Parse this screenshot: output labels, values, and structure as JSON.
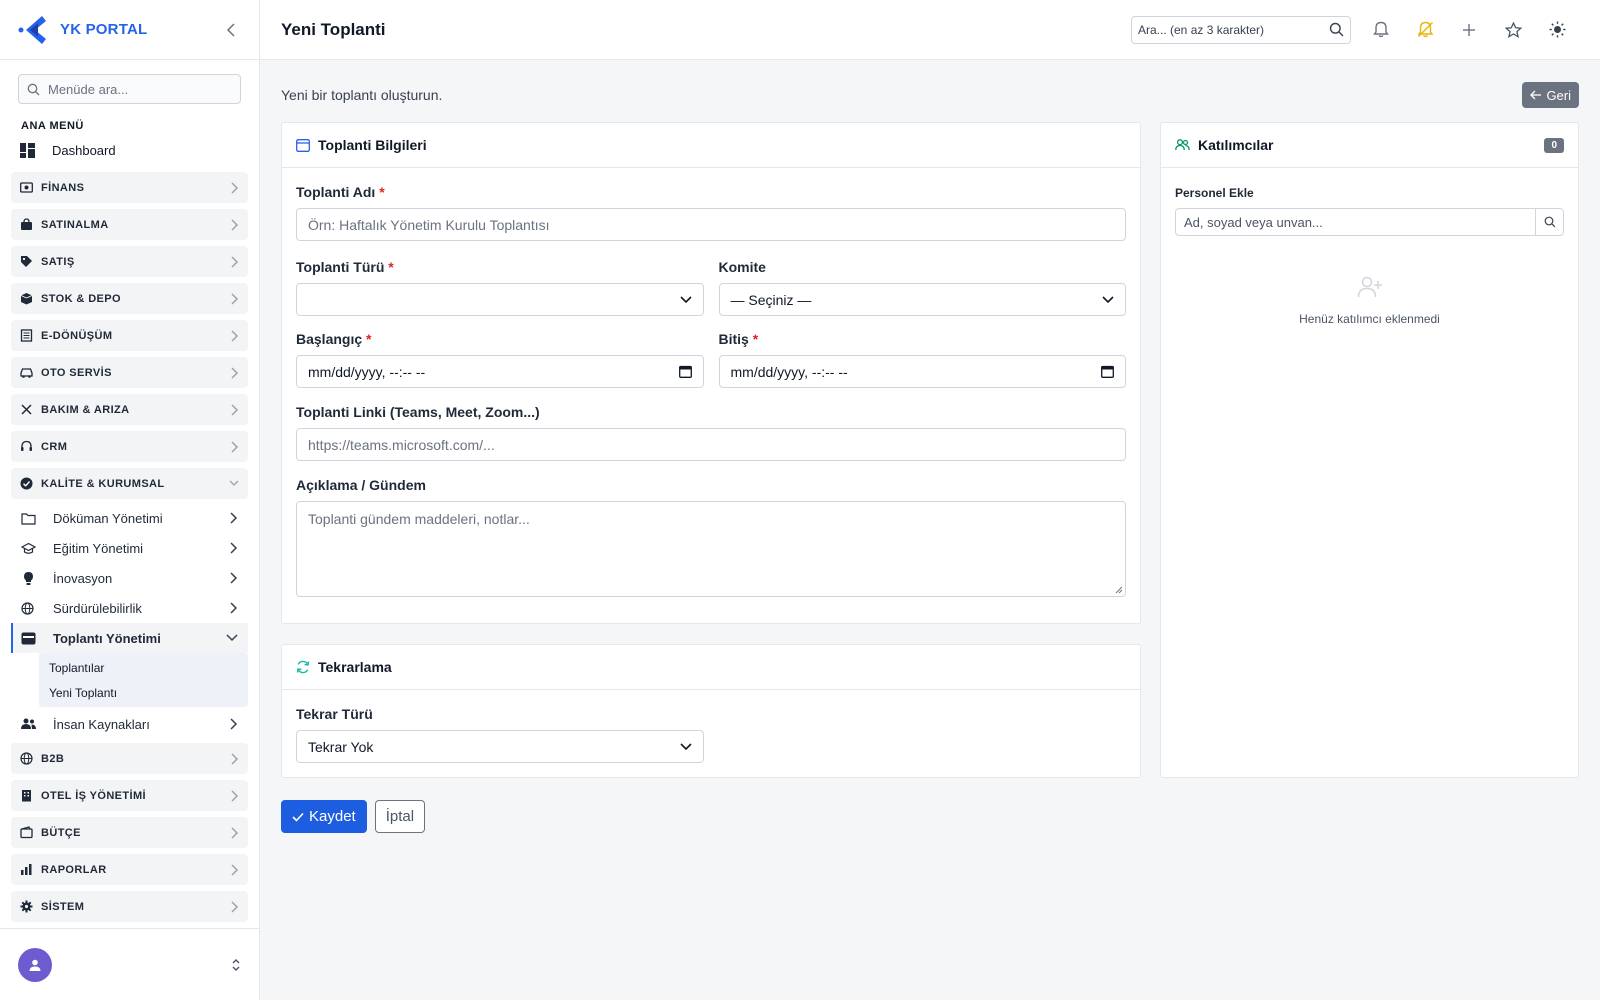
{
  "brand": {
    "name": "YK PORTAL"
  },
  "sidebar": {
    "search_placeholder": "Menüde ara...",
    "section_title": "ANA MENÜ",
    "dashboard": "Dashboard",
    "groups_top": [
      {
        "label": "FİNANS",
        "icon": "finance-icon"
      },
      {
        "label": "SATINALMA",
        "icon": "cart-icon"
      },
      {
        "label": "SATIŞ",
        "icon": "tag-icon"
      },
      {
        "label": "STOK & DEPO",
        "icon": "box-icon"
      },
      {
        "label": "E-DÖNÜŞÜM",
        "icon": "receipt-icon"
      },
      {
        "label": "OTO SERVİS",
        "icon": "car-icon"
      },
      {
        "label": "BAKIM & ARIZA",
        "icon": "tools-icon"
      },
      {
        "label": "CRM",
        "icon": "headset-icon"
      }
    ],
    "expanded_group": {
      "label": "KALİTE & KURUMSAL",
      "icon": "badge-check-icon"
    },
    "sub_items": [
      {
        "label": "Döküman Yönetimi",
        "icon": "folder-icon"
      },
      {
        "label": "Eğitim Yönetimi",
        "icon": "graduation-icon"
      },
      {
        "label": "İnovasyon",
        "icon": "lightbulb-icon"
      },
      {
        "label": "Sürdürülebilirlik",
        "icon": "globe-icon"
      }
    ],
    "active_sub": {
      "label": "Toplantı Yönetimi",
      "icon": "calendar-icon"
    },
    "active_children": [
      "Toplantılar",
      "Yeni Toplantı"
    ],
    "after_sub": {
      "label": "İnsan Kaynakları",
      "icon": "people-icon"
    },
    "groups_bottom": [
      {
        "label": "B2B",
        "icon": "globe-icon"
      },
      {
        "label": "OTEL İŞ YÖNETİMİ",
        "icon": "building-icon"
      },
      {
        "label": "BÜTÇE",
        "icon": "wallet-icon"
      },
      {
        "label": "RAPORLAR",
        "icon": "bar-chart-icon"
      },
      {
        "label": "SİSTEM",
        "icon": "gear-icon"
      }
    ]
  },
  "header": {
    "title": "Yeni Toplanti",
    "search_placeholder": "Ara... (en az 3 karakter)"
  },
  "main": {
    "intro": "Yeni bir toplantı oluşturun.",
    "back_label": "Geri",
    "meeting_card": {
      "title": "Toplanti Bilgileri",
      "name_label": "Toplanti Adı",
      "name_placeholder": "Örn: Haftalık Yönetim Kurulu Toplantısı",
      "type_label": "Toplanti Türü",
      "type_value": "",
      "committee_label": "Komite",
      "committee_value": "— Seçiniz —",
      "start_label": "Başlangıç",
      "start_value": "mm/dd/yyyy, --:-- --",
      "end_label": "Bitiş",
      "end_value": "mm/dd/yyyy, --:-- --",
      "link_label": "Toplanti Linki (Teams, Meet, Zoom...)",
      "link_placeholder": "https://teams.microsoft.com/...",
      "desc_label": "Açıklama / Gündem",
      "desc_placeholder": "Toplanti gündem maddeleri, notlar..."
    },
    "repeat_card": {
      "title": "Tekrarlama",
      "type_label": "Tekrar Türü",
      "type_value": "Tekrar Yok"
    },
    "participants_card": {
      "title": "Katılımcılar",
      "count": "0",
      "add_label": "Personel Ekle",
      "search_placeholder": "Ad, soyad veya unvan...",
      "empty_text": "Henüz katılımcı eklenmedi"
    },
    "save_label": "Kaydet",
    "cancel_label": "İptal"
  },
  "colors": {
    "primary": "#1d5ee0",
    "brand": "#2563eb",
    "required": "#dc2626",
    "muted_button": "#6b7280",
    "notify_accent": "#eab308"
  }
}
